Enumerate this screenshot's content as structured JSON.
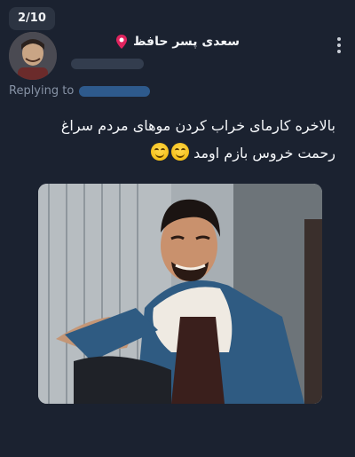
{
  "counter": "2/10",
  "author": {
    "display_name": "سعدی پسر حافظ",
    "avatar": "user-avatar",
    "badge_icon": "pin-icon"
  },
  "replying_to_label": "Replying to",
  "tweet": {
    "line1": "بالاخره کارمای خراب کردن موهای مردم سراغ",
    "line2": "رحمت خروس بازم اومد"
  },
  "media": {
    "description_icon": "laughing-man-photo"
  },
  "colors": {
    "background": "#1b2230",
    "text": "#f5f7fa",
    "muted": "#8793a6",
    "link": "#2e5a8c"
  }
}
